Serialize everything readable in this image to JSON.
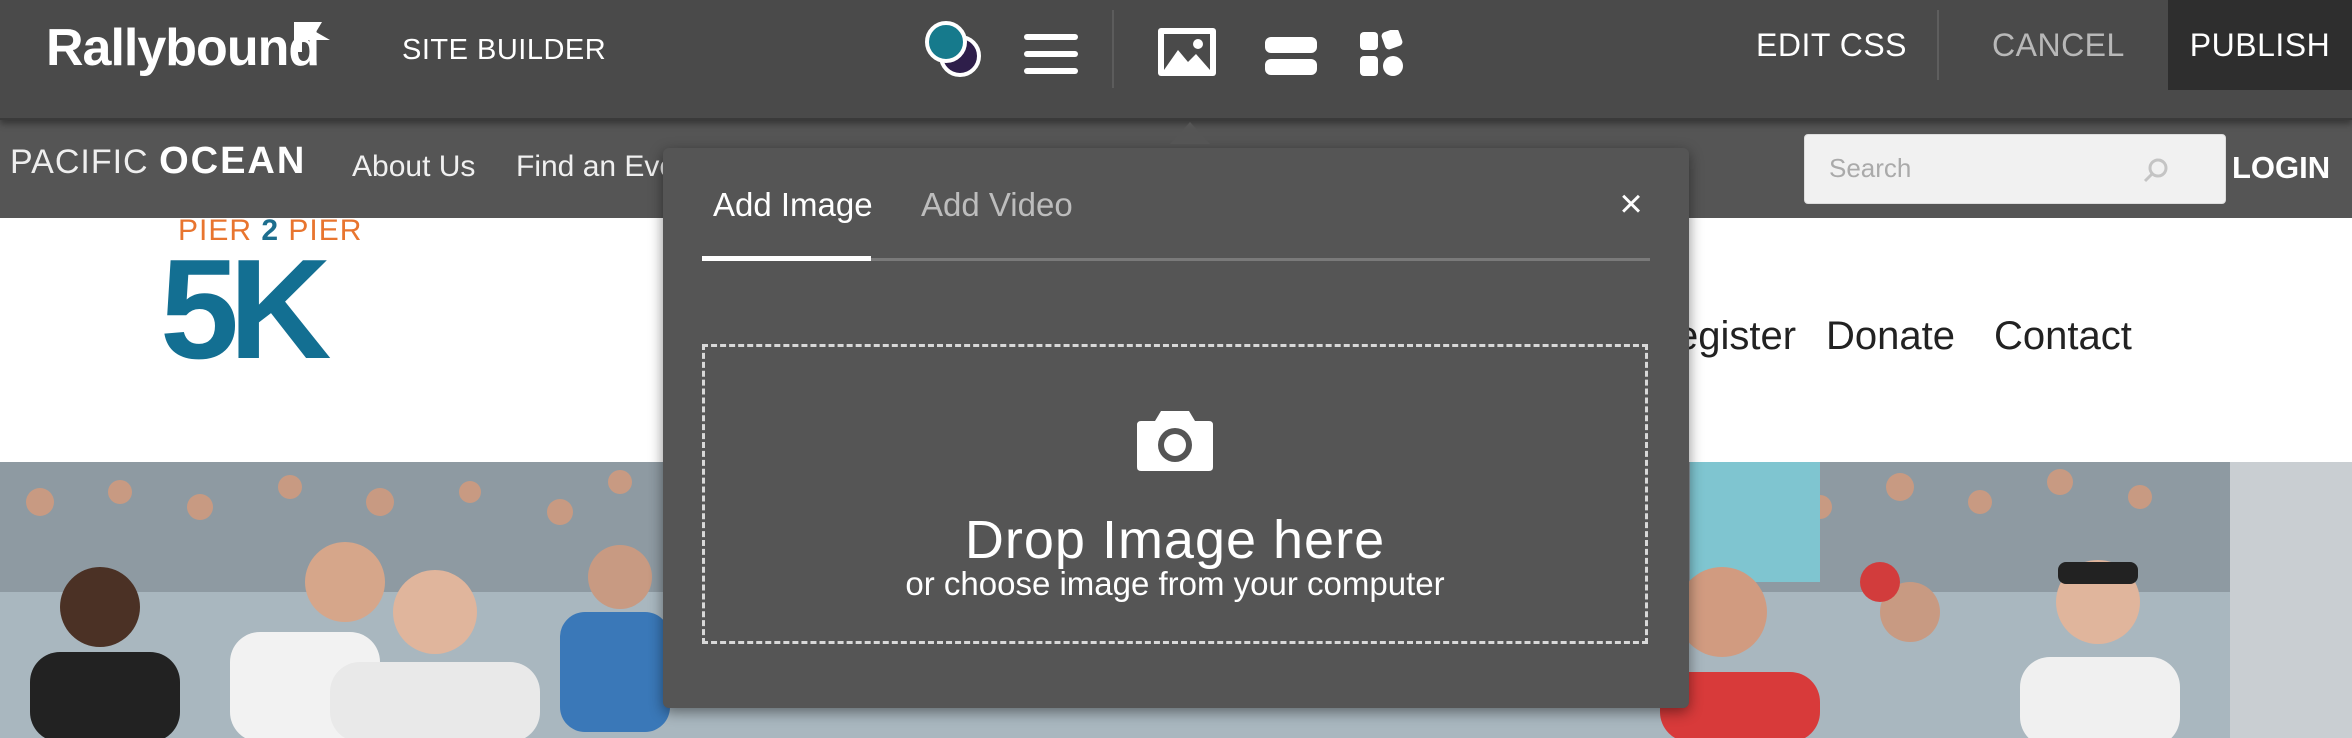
{
  "toolbar": {
    "brand": "Rallybound",
    "mode_label": "SITE BUILDER",
    "tools": [
      "theme-colors-icon",
      "menu-icon",
      "image-icon",
      "section-icon",
      "widgets-icon"
    ],
    "edit_css": "EDIT CSS",
    "cancel": "CANCEL",
    "publish": "PUBLISH"
  },
  "site_nav": {
    "brand_light": "PACIFIC",
    "brand_bold": "OCEAN",
    "links": [
      "About Us",
      "Find an Eve"
    ],
    "search_placeholder": "Search",
    "login": "LOGIN"
  },
  "site_header": {
    "logo_pier": "PIER",
    "logo_two": "2",
    "logo_pier2": "PIER",
    "logo_main": "5K",
    "nav": [
      "egister",
      "Donate",
      "Contact"
    ]
  },
  "modal": {
    "tabs": [
      "Add Image",
      "Add Video"
    ],
    "active_tab": "Add Image",
    "close": "×",
    "drop_title": "Drop Image here",
    "drop_subtitle": "or choose image from your computer"
  },
  "colors": {
    "toolbar_bg": "#4a4a4a",
    "modal_bg": "#555555",
    "publish_bg": "#2e2e2e",
    "logo_orange": "#e8752f",
    "logo_blue": "#136f92"
  }
}
